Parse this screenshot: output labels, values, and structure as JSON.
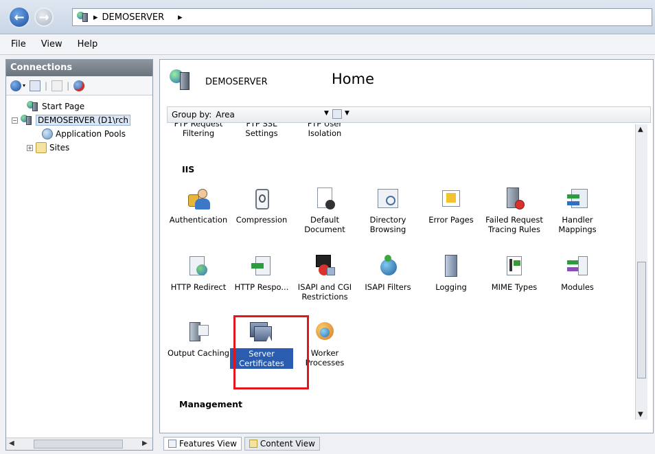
{
  "address": {
    "path": [
      "DEMOSERVER"
    ]
  },
  "menu": [
    "File",
    "View",
    "Help"
  ],
  "connections": {
    "title": "Connections",
    "tree": [
      {
        "label": "Start Page",
        "level": 1
      },
      {
        "label": "DEMOSERVER (D1\\rch",
        "level": 0,
        "expander": "−",
        "selected": true
      },
      {
        "label": "Application Pools",
        "level": 2
      },
      {
        "label": "Sites",
        "level": 1,
        "expander": "+"
      }
    ]
  },
  "main": {
    "server": "DEMOSERVER",
    "home": "Home",
    "group_by_label": "Group by:",
    "group_by_value": "Area",
    "top_row": [
      {
        "label": "FTP Request Filtering"
      },
      {
        "label": "FTP SSL Settings"
      },
      {
        "label": "FTP User Isolation"
      }
    ],
    "section_iis": "IIS",
    "iis_row1": [
      {
        "label": "Authentication",
        "icon": "authentication-icon"
      },
      {
        "label": "Compression",
        "icon": "compression-icon"
      },
      {
        "label": "Default Document",
        "icon": "default-document-icon"
      },
      {
        "label": "Directory Browsing",
        "icon": "directory-browsing-icon"
      },
      {
        "label": "Error Pages",
        "icon": "error-pages-icon"
      },
      {
        "label": "Failed Request Tracing Rules",
        "icon": "failed-request-icon"
      },
      {
        "label": "Handler Mappings",
        "icon": "handler-mappings-icon"
      }
    ],
    "iis_row2": [
      {
        "label": "HTTP Redirect",
        "icon": "http-redirect-icon"
      },
      {
        "label": "HTTP Respo...",
        "icon": "http-response-icon"
      },
      {
        "label": "ISAPI and CGI Restrictions",
        "icon": "isapi-cgi-icon"
      },
      {
        "label": "ISAPI Filters",
        "icon": "isapi-filters-icon"
      },
      {
        "label": "Logging",
        "icon": "logging-icon"
      },
      {
        "label": "MIME Types",
        "icon": "mime-types-icon"
      },
      {
        "label": "Modules",
        "icon": "modules-icon"
      }
    ],
    "iis_row3": [
      {
        "label": "Output Caching",
        "icon": "output-caching-icon"
      },
      {
        "label": "Server Certificates",
        "icon": "server-certificates-icon",
        "selected": true
      },
      {
        "label": "Worker Processes",
        "icon": "worker-processes-icon"
      }
    ],
    "section_management": "Management"
  },
  "bottom_tabs": [
    {
      "label": "Features View",
      "active": true
    },
    {
      "label": "Content View",
      "active": false
    }
  ],
  "colors": {
    "selection": "#2a5db0",
    "highlight_border": "#e0161c"
  }
}
